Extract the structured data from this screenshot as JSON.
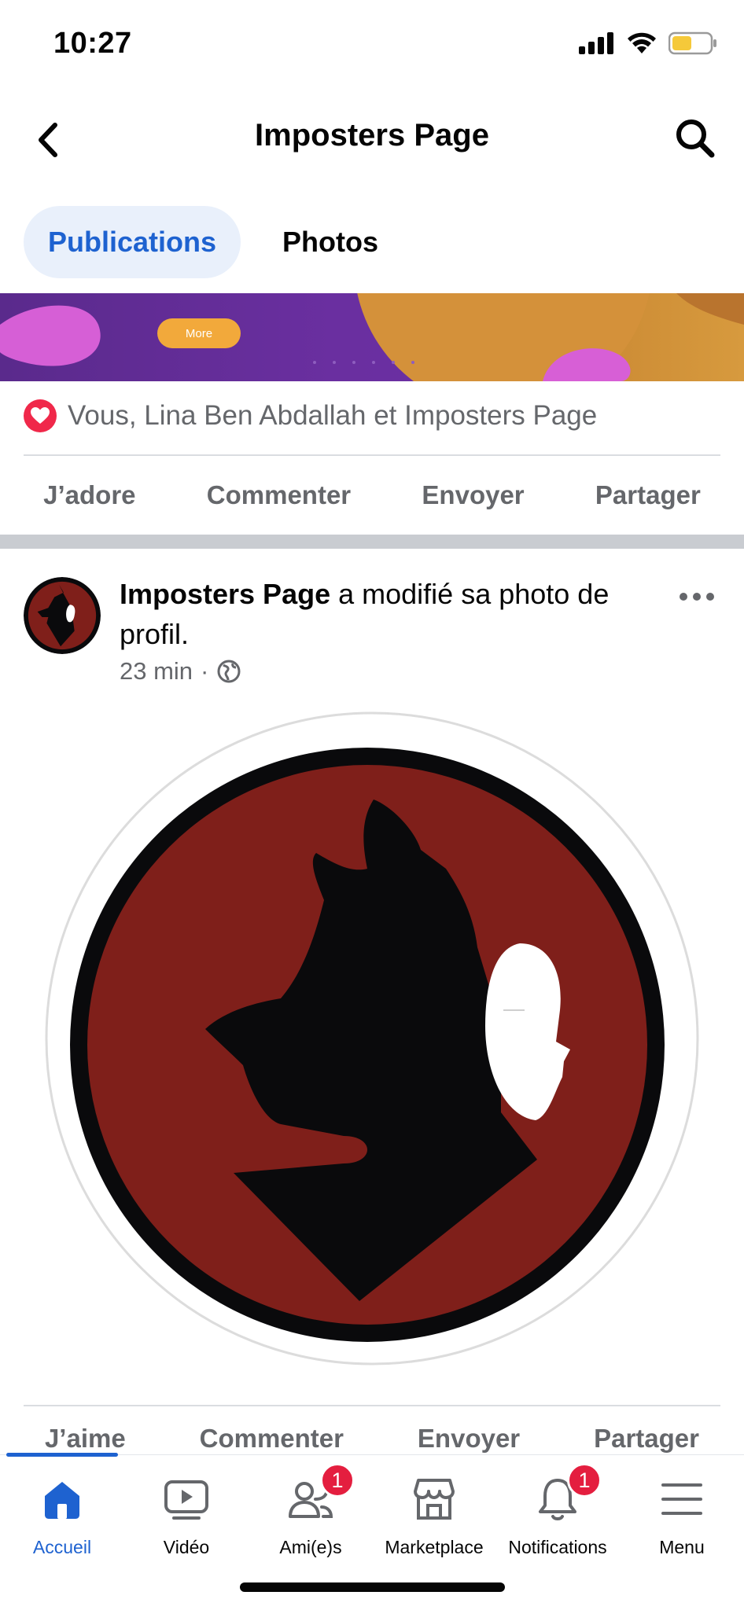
{
  "status_bar": {
    "time": "10:27"
  },
  "header": {
    "title": "Imposters Page"
  },
  "tabs": [
    {
      "label": "Publications",
      "active": true
    },
    {
      "label": "Photos",
      "active": false
    }
  ],
  "banner": {
    "button_label": "More"
  },
  "shared_post": {
    "reactions_text": "Vous, Lina Ben Abdallah et Imposters Page",
    "actions": [
      "J’adore",
      "Commenter",
      "Envoyer",
      "Partager"
    ]
  },
  "post": {
    "author": "Imposters Page",
    "action_text": " a modifié sa photo de profil.",
    "time": "23 min",
    "separator": "·",
    "actions": [
      "J’aime",
      "Commenter",
      "Envoyer",
      "Partager"
    ]
  },
  "bottom_nav": [
    {
      "label": "Accueil",
      "icon": "home-icon",
      "active": true,
      "badge": ""
    },
    {
      "label": "Vidéo",
      "icon": "video-icon",
      "active": false,
      "badge": ""
    },
    {
      "label": "Ami(e)s",
      "icon": "friends-icon",
      "active": false,
      "badge": "1"
    },
    {
      "label": "Marketplace",
      "icon": "marketplace-icon",
      "active": false,
      "badge": ""
    },
    {
      "label": "Notifications",
      "icon": "bell-icon",
      "active": false,
      "badge": "1"
    },
    {
      "label": "Menu",
      "icon": "menu-icon",
      "active": false,
      "badge": ""
    }
  ],
  "colors": {
    "accent": "#1e62d0",
    "badge": "#e41e3f",
    "logo_red": "#7f1f1a",
    "logo_black": "#0a0a0c"
  }
}
